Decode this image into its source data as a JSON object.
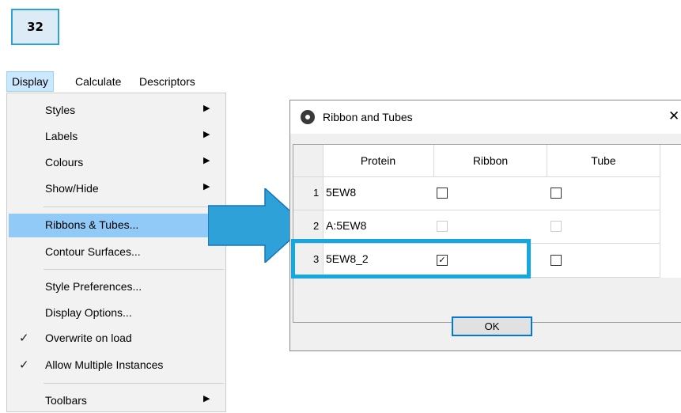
{
  "step_badge": "32",
  "menubar": {
    "items": [
      "Display",
      "Calculate",
      "Descriptors"
    ]
  },
  "menu": {
    "items": [
      {
        "label": "Styles",
        "submenu": true
      },
      {
        "label": "Labels",
        "submenu": true
      },
      {
        "label": "Colours",
        "submenu": true
      },
      {
        "label": "Show/Hide",
        "submenu": true
      },
      {
        "label": "Ribbons & Tubes...",
        "highlighted": true
      },
      {
        "label": "Contour Surfaces..."
      },
      {
        "label": "Style Preferences..."
      },
      {
        "label": "Display Options..."
      },
      {
        "label": "Overwrite on load",
        "checked": true
      },
      {
        "label": "Allow Multiple Instances",
        "checked": true
      },
      {
        "label": "Toolbars",
        "submenu": true
      }
    ],
    "check_glyph": "✓",
    "arrow_glyph": "▶"
  },
  "dialog": {
    "title": "Ribbon and Tubes",
    "close_glyph": "✕",
    "columns": [
      "Protein",
      "Ribbon",
      "Tube"
    ],
    "rows": [
      {
        "num": "1",
        "protein": "5EW8",
        "ribbon": false,
        "tube": false,
        "enabled": true
      },
      {
        "num": "2",
        "protein": "A:5EW8",
        "ribbon": false,
        "tube": false,
        "enabled": false
      },
      {
        "num": "3",
        "protein": "5EW8_2",
        "ribbon": true,
        "tube": false,
        "enabled": true
      }
    ],
    "checked_glyph": "✓",
    "ok_label": "OK"
  },
  "colors": {
    "arrow": "#2ea1d9",
    "highlight_box": "#14a7e0",
    "menu_highlight": "#91c9f7"
  },
  "icons": {
    "app": "molecule-icon",
    "arrow": "callout-arrow"
  }
}
